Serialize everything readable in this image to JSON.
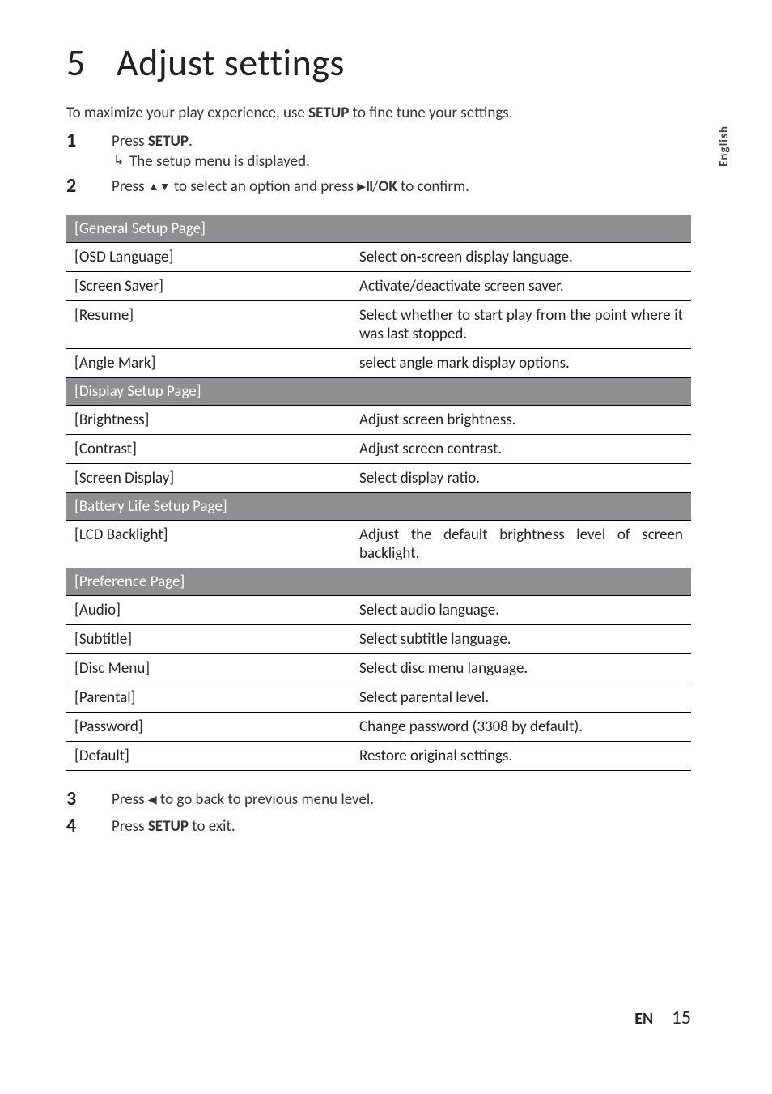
{
  "side_tab": "English",
  "chapter_number": "5",
  "chapter_title": "Adjust settings",
  "intro_prefix": "To maximize your play experience, use ",
  "intro_bold": "SETUP",
  "intro_suffix": " to fine tune your settings.",
  "steps": {
    "s1": {
      "num": "1",
      "pre": "Press ",
      "bold": "SETUP",
      "post": ".",
      "result": "The setup menu is displayed."
    },
    "s2": {
      "num": "2",
      "pre": "Press ",
      "mid": " to select an option and press ",
      "ok": "OK",
      "post": " to confirm."
    },
    "s3": {
      "num": "3",
      "pre": "Press ",
      "post": " to go back to previous menu level."
    },
    "s4": {
      "num": "4",
      "pre": "Press ",
      "bold": "SETUP",
      "post": " to exit."
    }
  },
  "sections": {
    "general": {
      "header": "[General Setup Page]",
      "rows": {
        "osd": {
          "label": "[OSD Language]",
          "desc": "Select on-screen display language."
        },
        "saver": {
          "label": "[Screen Saver]",
          "desc": "Activate/deactivate screen saver."
        },
        "resume": {
          "label": "[Resume]",
          "desc": "Select whether to start play from the point where it was last stopped."
        },
        "angle": {
          "label": "[Angle Mark]",
          "desc": "select angle mark display options."
        }
      }
    },
    "display": {
      "header": "[Display Setup Page]",
      "rows": {
        "bright": {
          "label": "[Brightness]",
          "desc": "Adjust screen brightness."
        },
        "contrast": {
          "label": "[Contrast]",
          "desc": "Adjust screen contrast."
        },
        "sd": {
          "label": "[Screen Display]",
          "desc": "Select display ratio."
        }
      }
    },
    "battery": {
      "header": "[Battery Life Setup Page]",
      "rows": {
        "lcd": {
          "label": "[LCD Backlight]",
          "desc": "Adjust the default brightness level of screen backlight."
        }
      }
    },
    "preference": {
      "header": "[Preference Page]",
      "rows": {
        "audio": {
          "label": "[Audio]",
          "desc": "Select audio language."
        },
        "subtitle": {
          "label": "[Subtitle]",
          "desc": "Select subtitle language."
        },
        "disc": {
          "label": "[Disc Menu]",
          "desc": "Select disc menu language."
        },
        "parental": {
          "label": "[Parental]",
          "desc": "Select parental level."
        },
        "password": {
          "label": "[Password]",
          "desc": "Change password (3308 by default)."
        },
        "default": {
          "label": "[Default]",
          "desc": "Restore original settings."
        }
      }
    }
  },
  "footer": {
    "lang": "EN",
    "page": "15"
  }
}
